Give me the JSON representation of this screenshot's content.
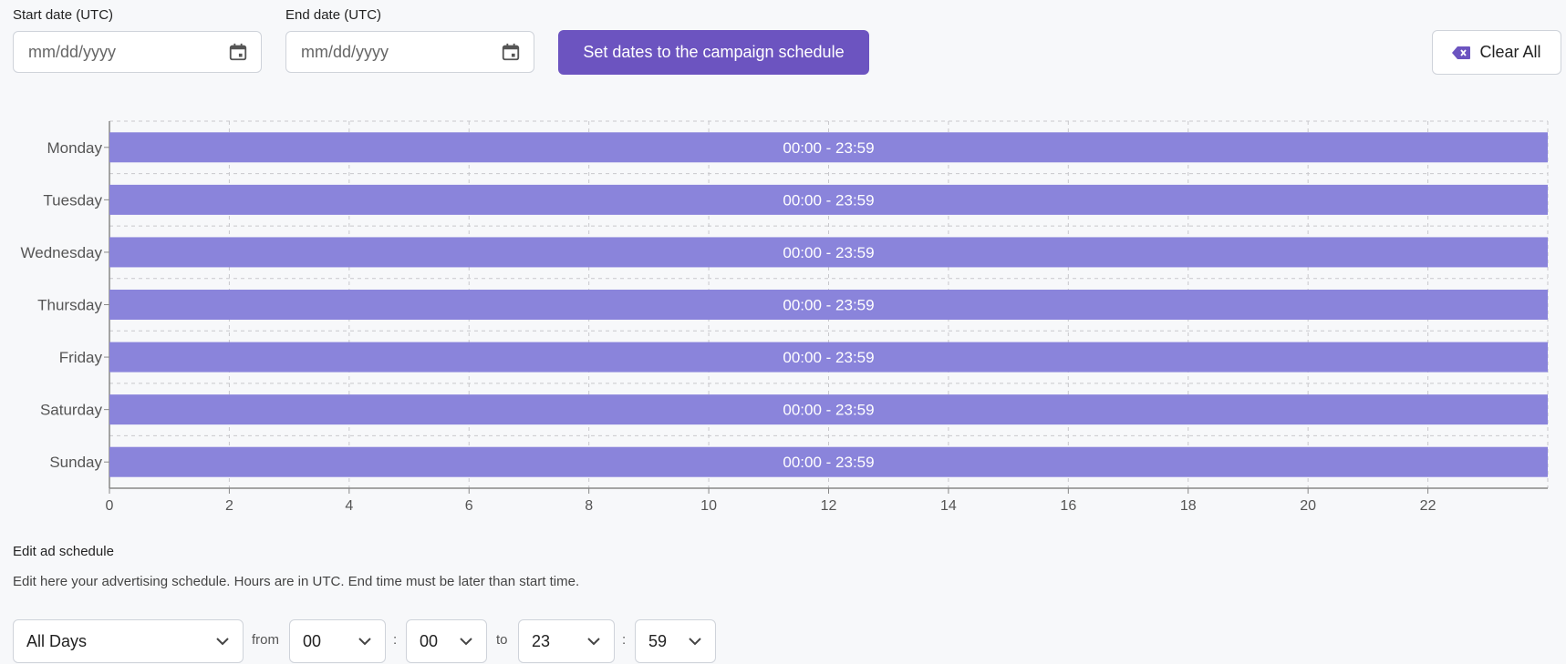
{
  "dates": {
    "start_label": "Start date (UTC)",
    "end_label": "End date (UTC)",
    "start_placeholder": "mm/dd/yyyy",
    "end_placeholder": "mm/dd/yyyy",
    "icon": "calendar-icon"
  },
  "actions": {
    "set_dates_label": "Set dates to the campaign schedule",
    "clear_all_label": "Clear All",
    "clear_icon": "backspace-icon"
  },
  "colors": {
    "accent": "#6c54c0",
    "bar": "#8a84db",
    "grid": "#c8c8cc",
    "axis": "#888888"
  },
  "chart_data": {
    "type": "bar",
    "orientation": "horizontal",
    "categories": [
      "Monday",
      "Tuesday",
      "Wednesday",
      "Thursday",
      "Friday",
      "Saturday",
      "Sunday"
    ],
    "series": [
      {
        "start": [
          0,
          0,
          0,
          0,
          0,
          0,
          0
        ],
        "end": [
          24,
          24,
          24,
          24,
          24,
          24,
          24
        ],
        "labels": [
          "00:00 - 23:59",
          "00:00 - 23:59",
          "00:00 - 23:59",
          "00:00 - 23:59",
          "00:00 - 23:59",
          "00:00 - 23:59",
          "00:00 - 23:59"
        ]
      }
    ],
    "xlim": [
      0,
      24
    ],
    "xticks": [
      0,
      2,
      4,
      6,
      8,
      10,
      12,
      14,
      16,
      18,
      20,
      22
    ],
    "xlabel": "",
    "ylabel": "",
    "title": "",
    "grid": true
  },
  "schedule": {
    "title": "Edit ad schedule",
    "description": "Edit here your advertising schedule. Hours are in UTC. End time must be later than start time.",
    "day_select": "All Days",
    "from_label": "from",
    "from_hour": "00",
    "colon": ":",
    "from_minute": "00",
    "to_label": "to",
    "to_hour": "23",
    "to_minute": "59"
  }
}
